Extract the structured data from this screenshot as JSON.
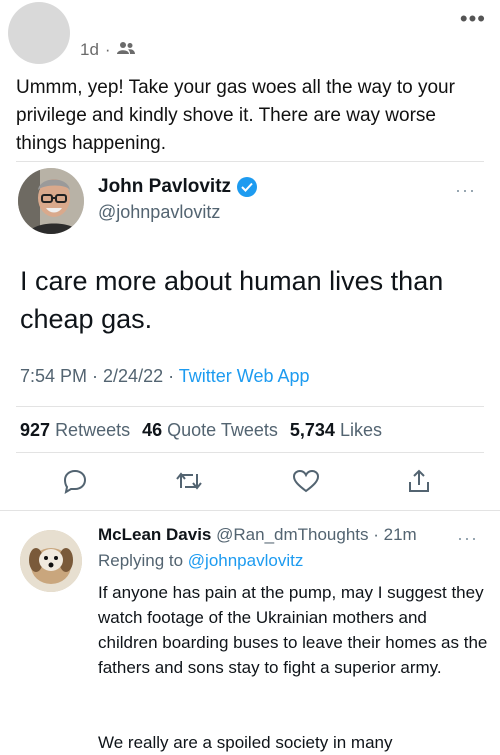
{
  "post": {
    "time": "1d",
    "separator": "·",
    "audience_icon": "friends-icon",
    "more_icon": "•••",
    "text": "Ummm, yep! Take your gas woes all the way to your privilege and kindly shove it. There are way worse things happening."
  },
  "tweet": {
    "author_name": "John Pavlovitz",
    "author_handle": "@johnpavlovitz",
    "verified_icon": "verified-check-icon",
    "more_icon": "···",
    "text": "I care more about human lives than cheap gas.",
    "time": "7:54 PM · 2/24/22 · ",
    "app": "Twitter Web App",
    "stats": {
      "retweets_count": "927",
      "retweets_label": "Retweets",
      "quotes_count": "46",
      "quotes_label": "Quote Tweets",
      "likes_count": "5,734",
      "likes_label": "Likes"
    },
    "actions": [
      "reply-icon",
      "retweet-icon",
      "like-icon",
      "share-icon"
    ]
  },
  "reply": {
    "author_name": "McLean Davis",
    "author_handle": "@Ran_dmThoughts",
    "time": " · 21m",
    "more_icon": "···",
    "replying_prefix": "Replying to ",
    "replying_handle": "@johnpavlovitz",
    "text": "If anyone has pain at the pump, may I suggest they watch footage of the Ukrainian mothers and children boarding buses to leave their homes as the fathers and sons stay to fight a superior army.",
    "text2": "We really are a spoiled society in many"
  },
  "colors": {
    "link": "#1d9bf0",
    "secondary": "#536471",
    "primary": "#0f1419"
  }
}
